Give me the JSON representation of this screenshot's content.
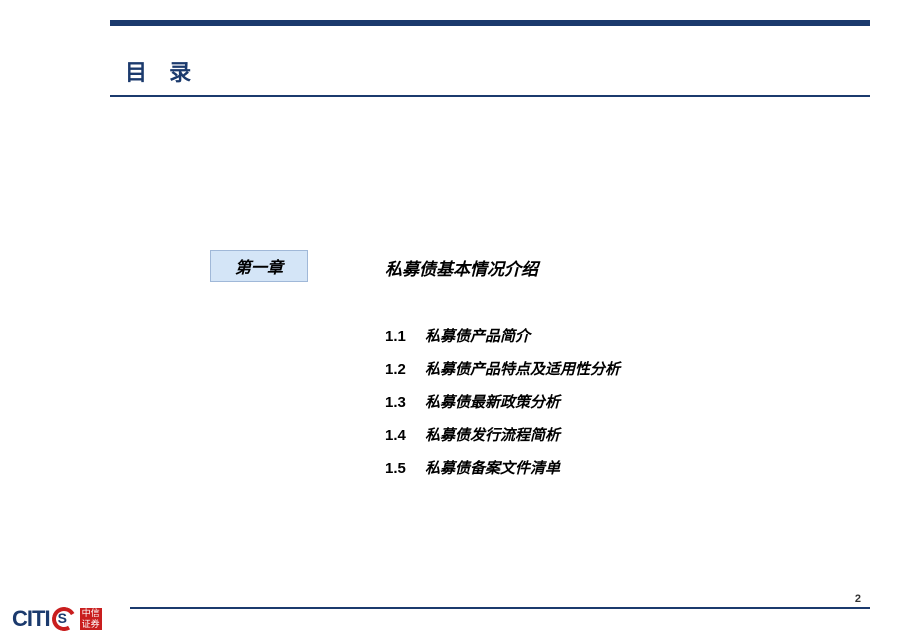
{
  "title": "目 录",
  "chapter": {
    "label": "第一章",
    "heading": "私募债基本情况介绍"
  },
  "toc": [
    {
      "num": "1.1",
      "text": "私募债产品简介"
    },
    {
      "num": "1.2",
      "text": "私募债产品特点及适用性分析"
    },
    {
      "num": "1.3",
      "text": "私募债最新政策分析"
    },
    {
      "num": "1.4",
      "text": "私募债发行流程简析"
    },
    {
      "num": "1.5",
      "text": "私募债备案文件清单"
    }
  ],
  "logo": {
    "text": "CITI",
    "s": "S",
    "cn1": "中信",
    "cn2": "证券"
  },
  "pageNumber": "2"
}
